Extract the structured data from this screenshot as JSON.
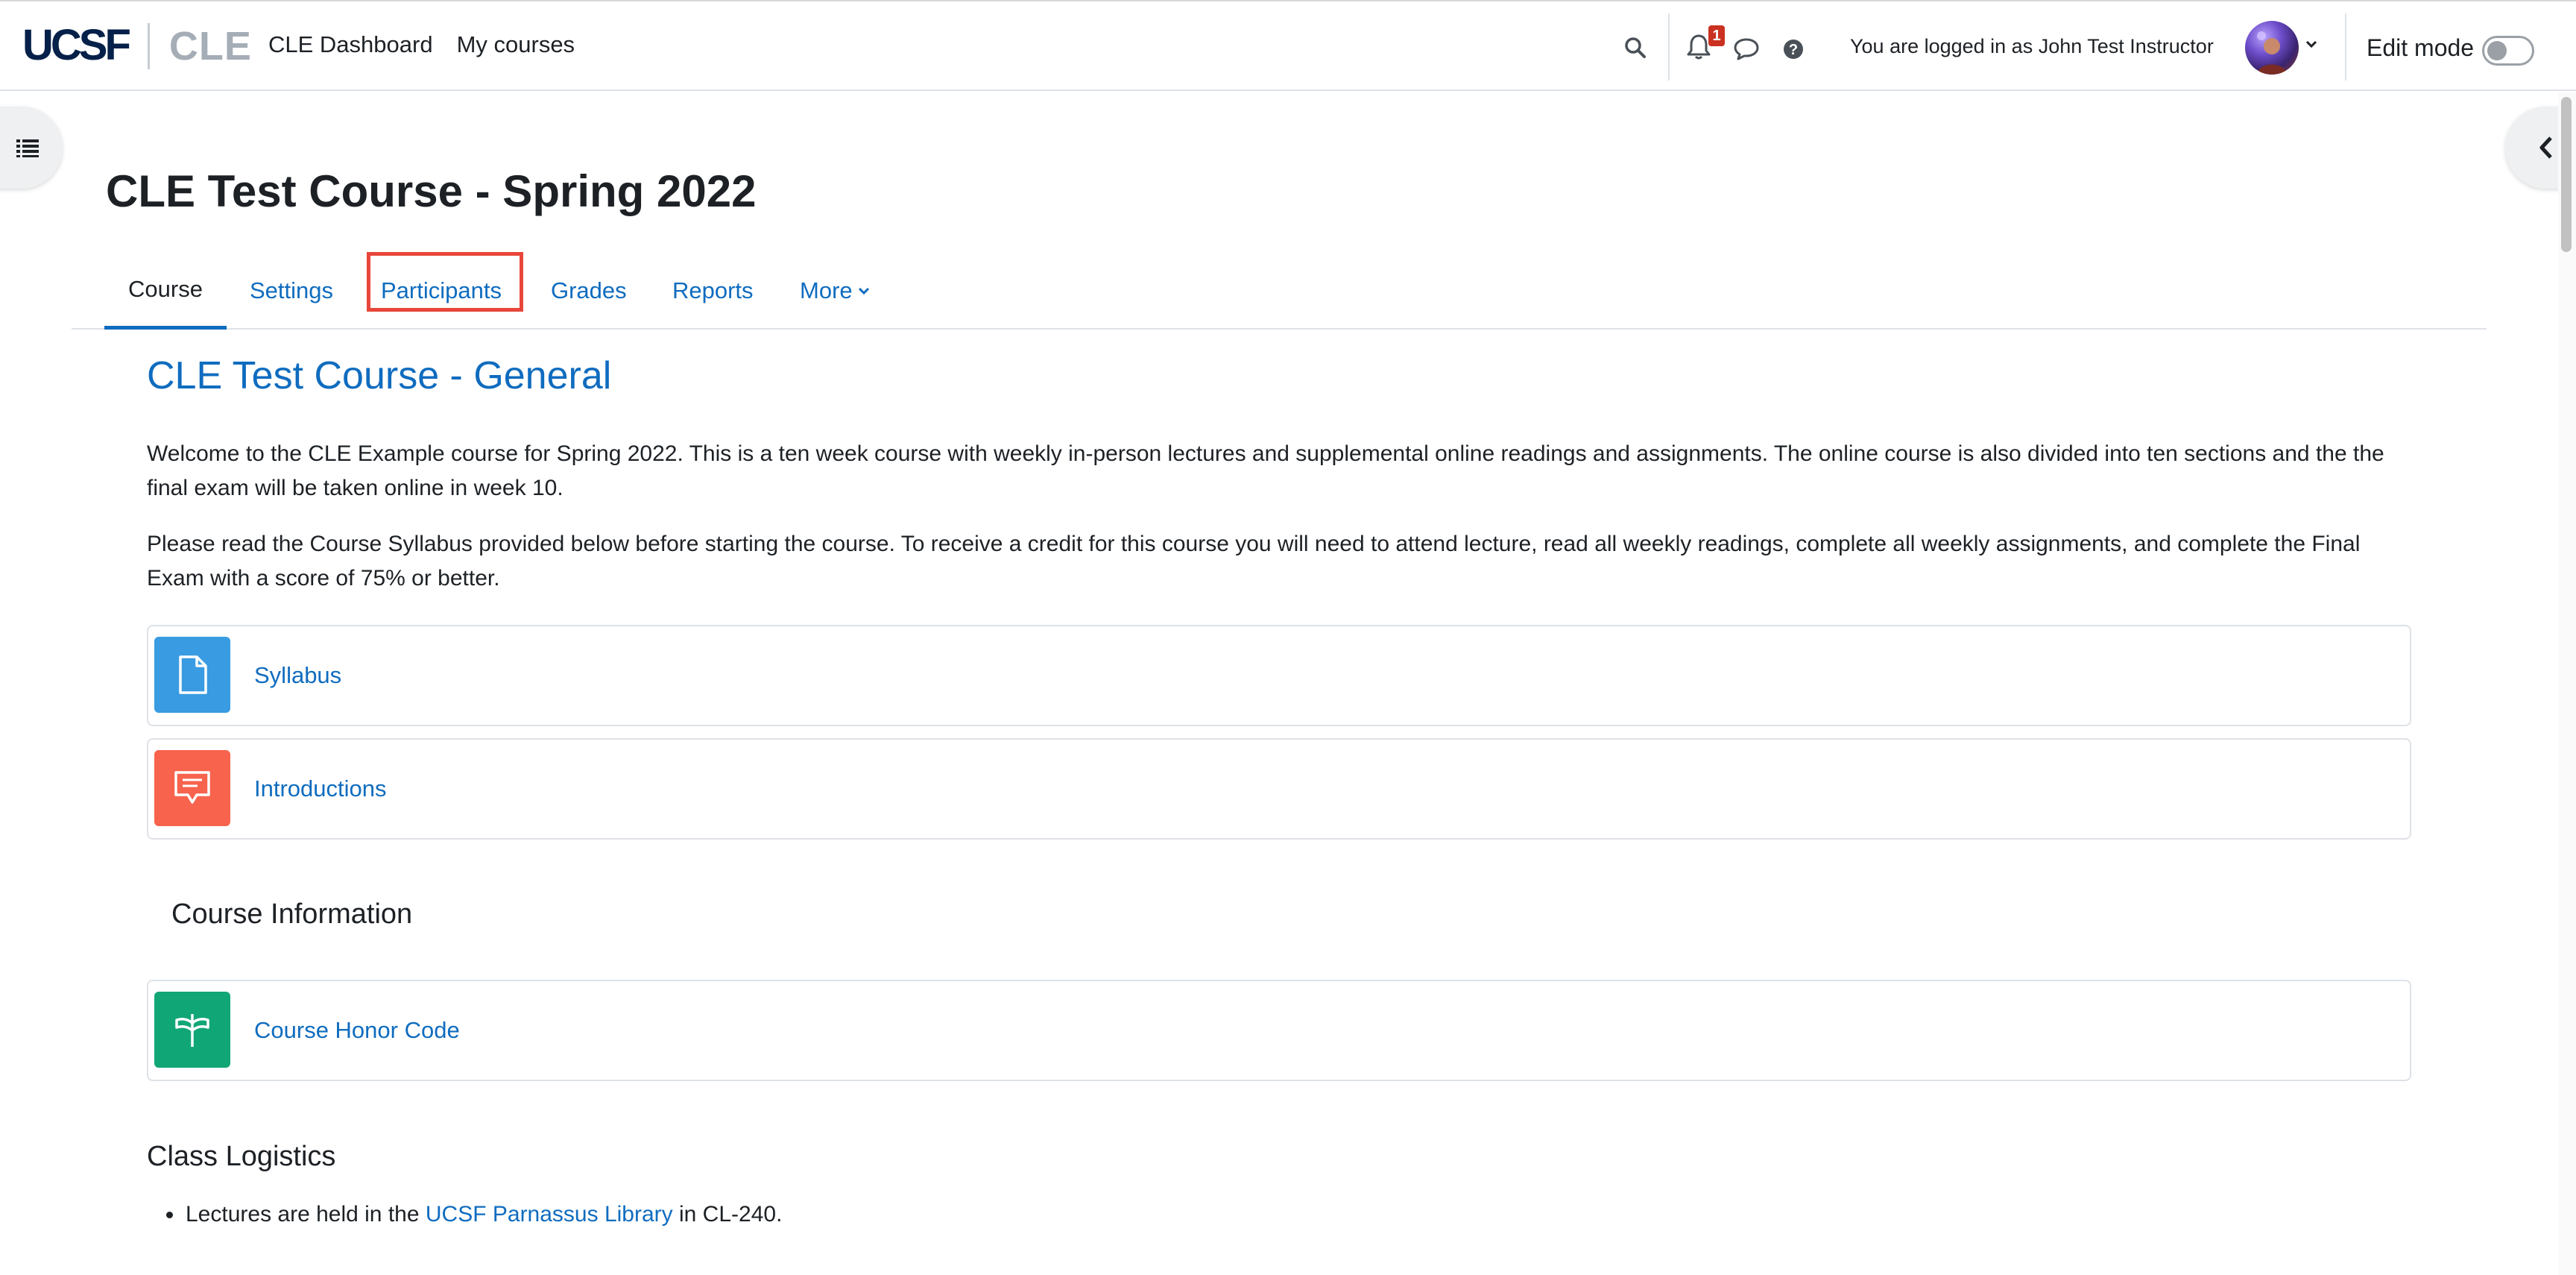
{
  "brand": {
    "logo_primary": "UCSF",
    "logo_secondary": "CLE"
  },
  "topnav": {
    "items": [
      {
        "label": "CLE Dashboard"
      },
      {
        "label": "My courses"
      }
    ]
  },
  "notifications": {
    "count": "1"
  },
  "user": {
    "logged_in_text": "You are logged in as John Test Instructor"
  },
  "edit_mode": {
    "label": "Edit mode",
    "enabled": false
  },
  "course": {
    "title": "CLE Test Course - Spring 2022"
  },
  "tabs": [
    {
      "label": "Course",
      "active": true
    },
    {
      "label": "Settings"
    },
    {
      "label": "Participants",
      "highlighted": true
    },
    {
      "label": "Grades"
    },
    {
      "label": "Reports"
    },
    {
      "label": "More"
    }
  ],
  "section": {
    "title": "CLE Test Course - General",
    "paragraphs": [
      "Welcome to the CLE Example course for Spring 2022. This is a ten week course with weekly in-person lectures and supplemental online readings and assignments. The online course is also divided into ten sections and the the final exam will be taken online in week 10.",
      "Please read the Course Syllabus provided below before starting the course. To receive a credit for this course you will need to attend lecture, read all weekly readings, complete all weekly assignments, and complete the Final Exam with a score of 75% or better."
    ],
    "activities": [
      {
        "label": "Syllabus",
        "icon": "file-icon",
        "color": "#399be2"
      },
      {
        "label": "Introductions",
        "icon": "forum-icon",
        "color": "#f7634d"
      }
    ]
  },
  "course_info": {
    "heading": "Course Information",
    "activities": [
      {
        "label": "Course Honor Code",
        "icon": "book-signpost-icon",
        "color": "#11a676"
      }
    ]
  },
  "logistics": {
    "heading": "Class Logistics",
    "bullet": {
      "prefix": "Lectures are held in the ",
      "link": "UCSF Parnassus Library",
      "suffix": " in CL-240."
    }
  },
  "colors": {
    "link": "#0f6cbf",
    "highlight": "#e8463a",
    "badge": "#ca3120"
  }
}
